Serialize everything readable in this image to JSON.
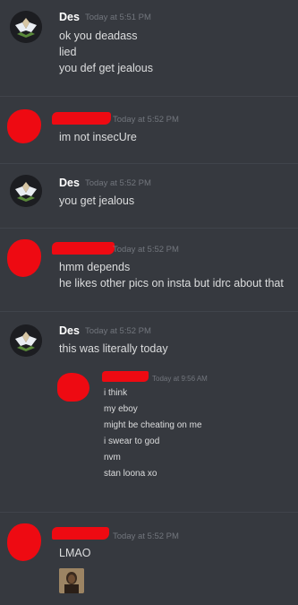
{
  "messages": [
    {
      "author": "Des",
      "timestamp": "Today at 5:51 PM",
      "lines": [
        "ok you deadass",
        "lied",
        "you def get jealous"
      ]
    },
    {
      "author": "",
      "timestamp": "Today at 5:52 PM",
      "lines": [
        "im not insecUre"
      ]
    },
    {
      "author": "Des",
      "timestamp": "Today at 5:52 PM",
      "lines": [
        "you get jealous"
      ]
    },
    {
      "author": "",
      "timestamp": "Today at 5:52 PM",
      "lines": [
        "hmm depends",
        "he likes other pics on insta but idrc about that"
      ]
    },
    {
      "author": "Des",
      "timestamp": "Today at 5:52 PM",
      "lines": [
        "this was literally today"
      ],
      "embedded_screenshot": {
        "timestamp": "Today at 9:56 AM",
        "lines": [
          "i think",
          "my eboy",
          "might be cheating on me",
          "i swear to god",
          "nvm",
          "stan loona xo"
        ]
      }
    },
    {
      "author": "",
      "timestamp": "Today at 5:52 PM",
      "lines": [
        "LMAO"
      ],
      "has_image_attachment": true
    }
  ],
  "colors": {
    "background": "#36393f",
    "username": "#ffffff",
    "message_text": "#dcddde",
    "timestamp": "#72767d",
    "redaction": "#ee0a12"
  }
}
